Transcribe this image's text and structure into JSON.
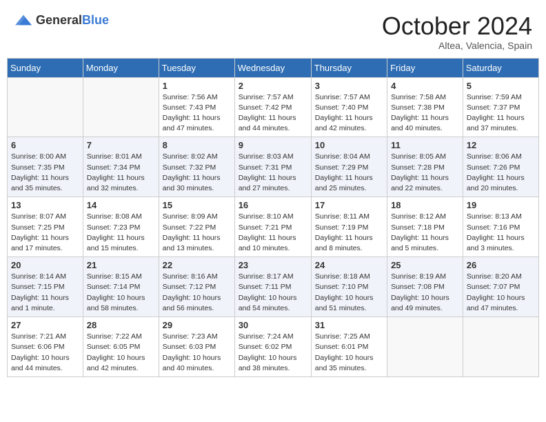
{
  "header": {
    "logo_general": "General",
    "logo_blue": "Blue",
    "month_title": "October 2024",
    "subtitle": "Altea, Valencia, Spain"
  },
  "days_of_week": [
    "Sunday",
    "Monday",
    "Tuesday",
    "Wednesday",
    "Thursday",
    "Friday",
    "Saturday"
  ],
  "weeks": [
    [
      {
        "num": "",
        "info": ""
      },
      {
        "num": "",
        "info": ""
      },
      {
        "num": "1",
        "info": "Sunrise: 7:56 AM\nSunset: 7:43 PM\nDaylight: 11 hours and 47 minutes."
      },
      {
        "num": "2",
        "info": "Sunrise: 7:57 AM\nSunset: 7:42 PM\nDaylight: 11 hours and 44 minutes."
      },
      {
        "num": "3",
        "info": "Sunrise: 7:57 AM\nSunset: 7:40 PM\nDaylight: 11 hours and 42 minutes."
      },
      {
        "num": "4",
        "info": "Sunrise: 7:58 AM\nSunset: 7:38 PM\nDaylight: 11 hours and 40 minutes."
      },
      {
        "num": "5",
        "info": "Sunrise: 7:59 AM\nSunset: 7:37 PM\nDaylight: 11 hours and 37 minutes."
      }
    ],
    [
      {
        "num": "6",
        "info": "Sunrise: 8:00 AM\nSunset: 7:35 PM\nDaylight: 11 hours and 35 minutes."
      },
      {
        "num": "7",
        "info": "Sunrise: 8:01 AM\nSunset: 7:34 PM\nDaylight: 11 hours and 32 minutes."
      },
      {
        "num": "8",
        "info": "Sunrise: 8:02 AM\nSunset: 7:32 PM\nDaylight: 11 hours and 30 minutes."
      },
      {
        "num": "9",
        "info": "Sunrise: 8:03 AM\nSunset: 7:31 PM\nDaylight: 11 hours and 27 minutes."
      },
      {
        "num": "10",
        "info": "Sunrise: 8:04 AM\nSunset: 7:29 PM\nDaylight: 11 hours and 25 minutes."
      },
      {
        "num": "11",
        "info": "Sunrise: 8:05 AM\nSunset: 7:28 PM\nDaylight: 11 hours and 22 minutes."
      },
      {
        "num": "12",
        "info": "Sunrise: 8:06 AM\nSunset: 7:26 PM\nDaylight: 11 hours and 20 minutes."
      }
    ],
    [
      {
        "num": "13",
        "info": "Sunrise: 8:07 AM\nSunset: 7:25 PM\nDaylight: 11 hours and 17 minutes."
      },
      {
        "num": "14",
        "info": "Sunrise: 8:08 AM\nSunset: 7:23 PM\nDaylight: 11 hours and 15 minutes."
      },
      {
        "num": "15",
        "info": "Sunrise: 8:09 AM\nSunset: 7:22 PM\nDaylight: 11 hours and 13 minutes."
      },
      {
        "num": "16",
        "info": "Sunrise: 8:10 AM\nSunset: 7:21 PM\nDaylight: 11 hours and 10 minutes."
      },
      {
        "num": "17",
        "info": "Sunrise: 8:11 AM\nSunset: 7:19 PM\nDaylight: 11 hours and 8 minutes."
      },
      {
        "num": "18",
        "info": "Sunrise: 8:12 AM\nSunset: 7:18 PM\nDaylight: 11 hours and 5 minutes."
      },
      {
        "num": "19",
        "info": "Sunrise: 8:13 AM\nSunset: 7:16 PM\nDaylight: 11 hours and 3 minutes."
      }
    ],
    [
      {
        "num": "20",
        "info": "Sunrise: 8:14 AM\nSunset: 7:15 PM\nDaylight: 11 hours and 1 minute."
      },
      {
        "num": "21",
        "info": "Sunrise: 8:15 AM\nSunset: 7:14 PM\nDaylight: 10 hours and 58 minutes."
      },
      {
        "num": "22",
        "info": "Sunrise: 8:16 AM\nSunset: 7:12 PM\nDaylight: 10 hours and 56 minutes."
      },
      {
        "num": "23",
        "info": "Sunrise: 8:17 AM\nSunset: 7:11 PM\nDaylight: 10 hours and 54 minutes."
      },
      {
        "num": "24",
        "info": "Sunrise: 8:18 AM\nSunset: 7:10 PM\nDaylight: 10 hours and 51 minutes."
      },
      {
        "num": "25",
        "info": "Sunrise: 8:19 AM\nSunset: 7:08 PM\nDaylight: 10 hours and 49 minutes."
      },
      {
        "num": "26",
        "info": "Sunrise: 8:20 AM\nSunset: 7:07 PM\nDaylight: 10 hours and 47 minutes."
      }
    ],
    [
      {
        "num": "27",
        "info": "Sunrise: 7:21 AM\nSunset: 6:06 PM\nDaylight: 10 hours and 44 minutes."
      },
      {
        "num": "28",
        "info": "Sunrise: 7:22 AM\nSunset: 6:05 PM\nDaylight: 10 hours and 42 minutes."
      },
      {
        "num": "29",
        "info": "Sunrise: 7:23 AM\nSunset: 6:03 PM\nDaylight: 10 hours and 40 minutes."
      },
      {
        "num": "30",
        "info": "Sunrise: 7:24 AM\nSunset: 6:02 PM\nDaylight: 10 hours and 38 minutes."
      },
      {
        "num": "31",
        "info": "Sunrise: 7:25 AM\nSunset: 6:01 PM\nDaylight: 10 hours and 35 minutes."
      },
      {
        "num": "",
        "info": ""
      },
      {
        "num": "",
        "info": ""
      }
    ]
  ]
}
